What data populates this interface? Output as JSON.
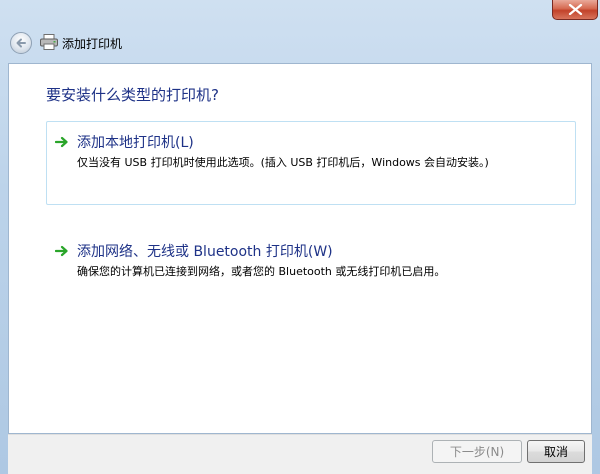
{
  "window": {
    "title": "添加打印机"
  },
  "content": {
    "question": "要安装什么类型的打印机?",
    "options": [
      {
        "title": "添加本地打印机(L)",
        "description": "仅当没有 USB 打印机时使用此选项。(插入 USB 打印机后，Windows 会自动安装。)"
      },
      {
        "title": "添加网络、无线或 Bluetooth 打印机(W)",
        "description": "确保您的计算机已连接到网络，或者您的 Bluetooth 或无线打印机已启用。"
      }
    ]
  },
  "footer": {
    "next_label": "下一步(N)",
    "cancel_label": "取消"
  },
  "icons": {
    "back": "back-arrow-icon",
    "printer": "printer-icon",
    "close": "close-icon",
    "option_arrow": "green-arrow-icon"
  },
  "colors": {
    "accent_text": "#1e3287",
    "option_arrow": "#2aa52a",
    "close_button": "#c2422a"
  }
}
